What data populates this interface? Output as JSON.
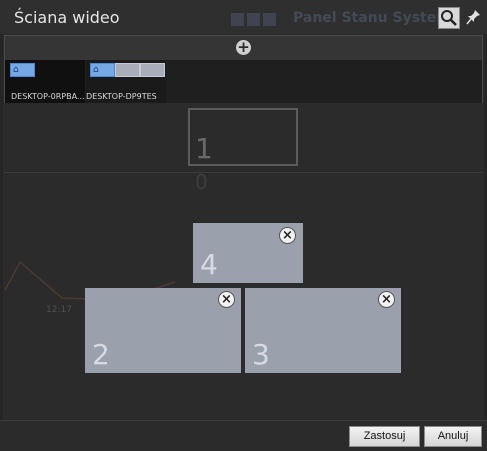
{
  "window": {
    "title": "Ściana wideo"
  },
  "background_ghost": {
    "title": "Panel Stanu System",
    "zero": "0",
    "time": "12:17"
  },
  "toolbar": {
    "search_icon": "search-icon",
    "pin_icon": "pin-icon",
    "add_icon": "plus-circle-icon"
  },
  "monitors": [
    {
      "name": "DESKTOP-0RPBA...",
      "screens": [
        {
          "active": true
        }
      ]
    },
    {
      "name": "DESKTOP-DP9TES",
      "screens": [
        {
          "active": true
        },
        {
          "active": false
        },
        {
          "active": false
        }
      ]
    }
  ],
  "layout": {
    "outline_label": "1",
    "panels": [
      {
        "label": "4",
        "close": "×"
      },
      {
        "label": "2",
        "close": "×"
      },
      {
        "label": "3",
        "close": "×"
      }
    ]
  },
  "footer": {
    "apply_label": "Zastosuj",
    "cancel_label": "Anuluj"
  },
  "colors": {
    "panel": "#9ba0ad",
    "active_screen": "#74a9e6",
    "background": "#2b2b2b"
  }
}
